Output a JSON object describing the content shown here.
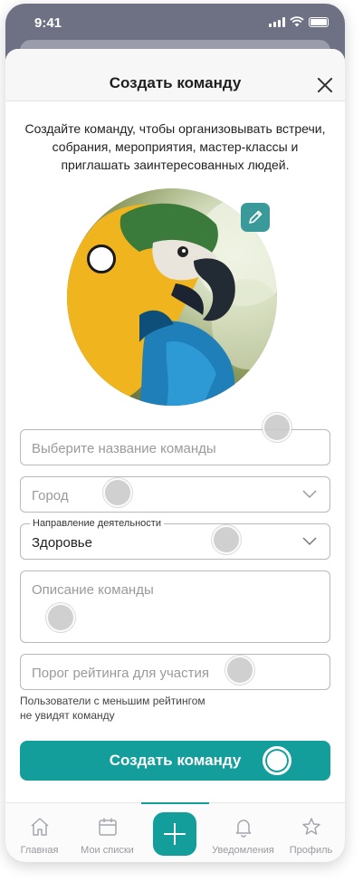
{
  "status_bar": {
    "time": "9:41"
  },
  "header": {
    "title": "Создать команду"
  },
  "intro_text": "Создайте команду, чтобы организовывать встречи, собрания, мероприятия, мастер-классы и приглашать заинтересованных людей.",
  "form": {
    "team_name": {
      "placeholder": "Выберите название команды",
      "value": ""
    },
    "city": {
      "placeholder": "Город",
      "value": ""
    },
    "activity": {
      "label": "Направление деятельности",
      "value": "Здоровье"
    },
    "description": {
      "placeholder": "Описание команды",
      "value": ""
    },
    "rating_threshold": {
      "placeholder": "Порог рейтинга для участия",
      "value": ""
    },
    "rating_hint_line1": "Пользователи с меньшим рейтингом",
    "rating_hint_line2": "не увидят команду"
  },
  "primary_button": {
    "label": "Создать команду"
  },
  "tabbar": {
    "items": [
      {
        "label": "Главная",
        "icon": "home-icon"
      },
      {
        "label": "Мои списки",
        "icon": "calendar-icon"
      },
      {
        "label": "",
        "icon": "plus-icon"
      },
      {
        "label": "Уведомления",
        "icon": "bell-icon"
      },
      {
        "label": "Профиль",
        "icon": "star-icon"
      }
    ]
  },
  "colors": {
    "accent": "#139e9c",
    "edit_button": "#3a9a9a",
    "backdrop": "#6e7183"
  }
}
